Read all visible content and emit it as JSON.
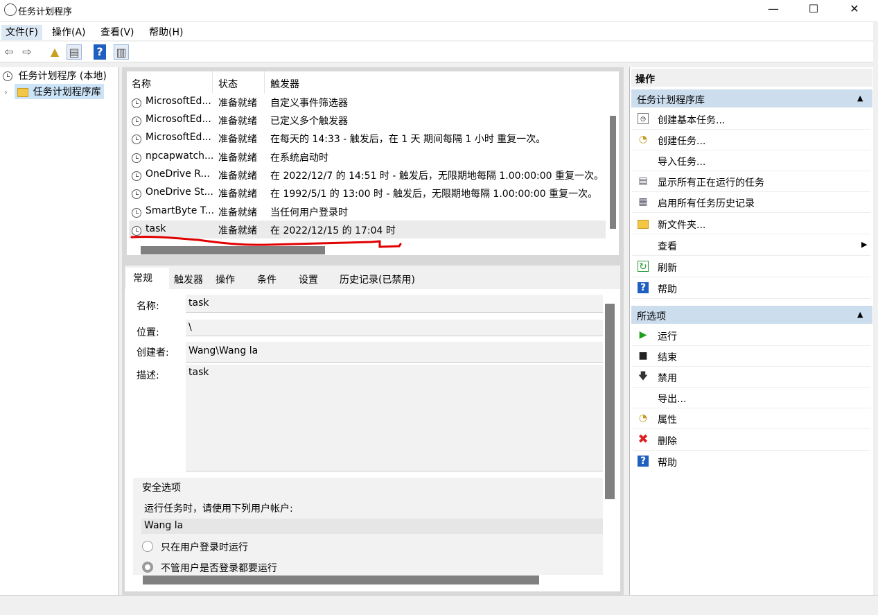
{
  "window": {
    "title": "任务计划程序",
    "minimize": "—",
    "maximize": "☐",
    "close": "✕"
  },
  "menu": [
    {
      "label": "文件(F)"
    },
    {
      "label": "操作(A)"
    },
    {
      "label": "查看(V)"
    },
    {
      "label": "帮助(H)"
    }
  ],
  "toolbar": {
    "back": "⇦",
    "forward": "⇨",
    "help": "?"
  },
  "tree": {
    "root": "任务计划程序 (本地)",
    "child": "任务计划程序库",
    "expander": "›"
  },
  "task_list": {
    "columns": [
      "名称",
      "状态",
      "触发器"
    ],
    "rows": [
      {
        "name": "MicrosoftEd...",
        "status": "准备就绪",
        "trigger": "自定义事件筛选器"
      },
      {
        "name": "MicrosoftEd...",
        "status": "准备就绪",
        "trigger": "已定义多个触发器"
      },
      {
        "name": "MicrosoftEd...",
        "status": "准备就绪",
        "trigger": "在每天的 14:33 - 触发后，在 1 天 期间每隔 1 小时 重复一次。"
      },
      {
        "name": "npcapwatch...",
        "status": "准备就绪",
        "trigger": "在系统启动时"
      },
      {
        "name": "OneDrive R...",
        "status": "准备就绪",
        "trigger": "在 2022/12/7 的 14:51 时 - 触发后，无限期地每隔 1.00:00:00 重复一次。"
      },
      {
        "name": "OneDrive St...",
        "status": "准备就绪",
        "trigger": "在 1992/5/1 的 13:00 时 - 触发后，无限期地每隔 1.00:00:00 重复一次。"
      },
      {
        "name": "SmartByte T...",
        "status": "准备就绪",
        "trigger": "当任何用户登录时"
      },
      {
        "name": "task",
        "status": "准备就绪",
        "trigger": "在 2022/12/15 的 17:04 时"
      }
    ]
  },
  "details": {
    "tabs": [
      "常规",
      "触发器",
      "操作",
      "条件",
      "设置",
      "历史记录(已禁用)"
    ],
    "name_label": "名称:",
    "name_value": "task",
    "location_label": "位置:",
    "location_value": "\\",
    "author_label": "创建者:",
    "author_value": "Wang\\Wang la",
    "desc_label": "描述:",
    "desc_value": "task",
    "security_title": "安全选项",
    "run_as_text": "运行任务时，请使用下列用户帐户:",
    "run_as_user": "Wang la",
    "radio1": "只在用户登录时运行",
    "radio2": "不管用户是否登录都要运行"
  },
  "actions": {
    "header": "操作",
    "section1": "任务计划程序库",
    "items1": [
      {
        "label": "创建基本任务...",
        "icon": "calendar-icon"
      },
      {
        "label": "创建任务...",
        "icon": "clock-icon"
      },
      {
        "label": "导入任务...",
        "icon": ""
      },
      {
        "label": "显示所有正在运行的任务",
        "icon": "list-icon"
      },
      {
        "label": "启用所有任务历史记录",
        "icon": "document-icon"
      },
      {
        "label": "新文件夹...",
        "icon": "folder-icon"
      },
      {
        "label": "查看",
        "icon": "",
        "submenu": "▶"
      },
      {
        "label": "刷新",
        "icon": "refresh-icon"
      },
      {
        "label": "帮助",
        "icon": "help-icon"
      }
    ],
    "section2": "所选项",
    "items2": [
      {
        "label": "运行",
        "icon": "play-icon"
      },
      {
        "label": "结束",
        "icon": "stop-icon"
      },
      {
        "label": "禁用",
        "icon": "disable-icon"
      },
      {
        "label": "导出...",
        "icon": ""
      },
      {
        "label": "属性",
        "icon": "clock-icon"
      },
      {
        "label": "删除",
        "icon": "delete-icon"
      },
      {
        "label": "帮助",
        "icon": "help-icon"
      }
    ],
    "collapse_glyph": "▲"
  }
}
